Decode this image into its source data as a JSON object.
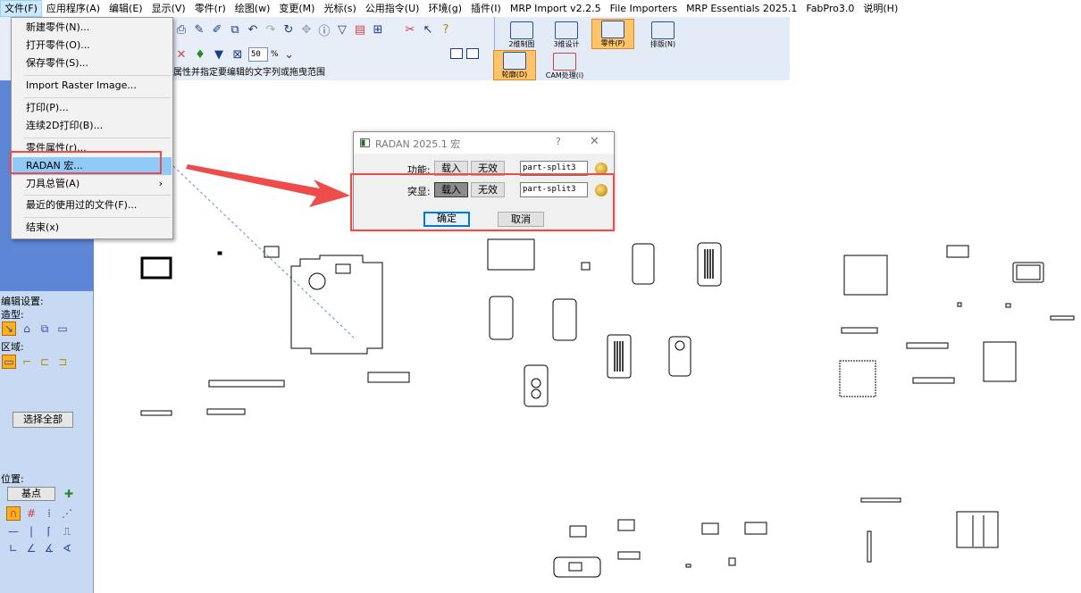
{
  "menubar": {
    "items": [
      {
        "label": "文件(F)"
      },
      {
        "label": "应用程序(A)"
      },
      {
        "label": "编辑(E)"
      },
      {
        "label": "显示(V)"
      },
      {
        "label": "零件(r)"
      },
      {
        "label": "绘图(w)"
      },
      {
        "label": "变更(M)"
      },
      {
        "label": "光标(s)"
      },
      {
        "label": "公用指令(U)"
      },
      {
        "label": "环境(g)"
      },
      {
        "label": "插件(I)"
      },
      {
        "label": "MRP Import v2.2.5"
      },
      {
        "label": "File Importers"
      },
      {
        "label": "MRP Essentials 2025.1"
      },
      {
        "label": "FabPro3.0"
      },
      {
        "label": "说明(H)"
      }
    ]
  },
  "file_menu": {
    "items": [
      {
        "label": "新建零件(N)..."
      },
      {
        "label": "打开零件(O)..."
      },
      {
        "label": "保存零件(S)..."
      },
      {
        "label": "Import Raster Image..."
      },
      {
        "label": "打印(P)..."
      },
      {
        "label": "连续2D打印(B)..."
      },
      {
        "label": "零件属性(r)..."
      },
      {
        "label": "RADAN 宏..."
      },
      {
        "label": "刀具总管(A)"
      },
      {
        "label": "最近的使用过的文件(F)..."
      },
      {
        "label": "结束(x)"
      }
    ],
    "submenu_arrow": "›"
  },
  "toolbar": {
    "zoom_value": "50",
    "zoom_unit": "%",
    "hint": "属性并指定要编辑的文字列或拖曳范围"
  },
  "mode_tabs": [
    {
      "label": "2维制图"
    },
    {
      "label": "3维设计"
    },
    {
      "label": "零件(P)"
    },
    {
      "label": "排版(N)"
    },
    {
      "label": "轮廓(D)"
    },
    {
      "label": "CAM处理(i)"
    }
  ],
  "left_panel": {
    "edit_settings": "编辑设置:",
    "shape": "造型:",
    "region": "区域:",
    "select_all": "选择全部",
    "position": "位置:",
    "base_point": "基点"
  },
  "dialog": {
    "title": "RADAN 2025.1 宏",
    "help": "?",
    "close": "✕",
    "rows": [
      {
        "label": "功能:",
        "load": "载入",
        "disable": "无效",
        "value": "part-split3"
      },
      {
        "label": "突显:",
        "load": "载入",
        "disable": "无效",
        "value": "part-split3"
      }
    ],
    "ok": "确定",
    "cancel": "取消"
  },
  "colors": {
    "highlight_red": "#ee4b4b",
    "menu_hover": "#91c9f7",
    "left_panel_blue": "#5d86d6",
    "selected_tab": "#ffc46a"
  }
}
